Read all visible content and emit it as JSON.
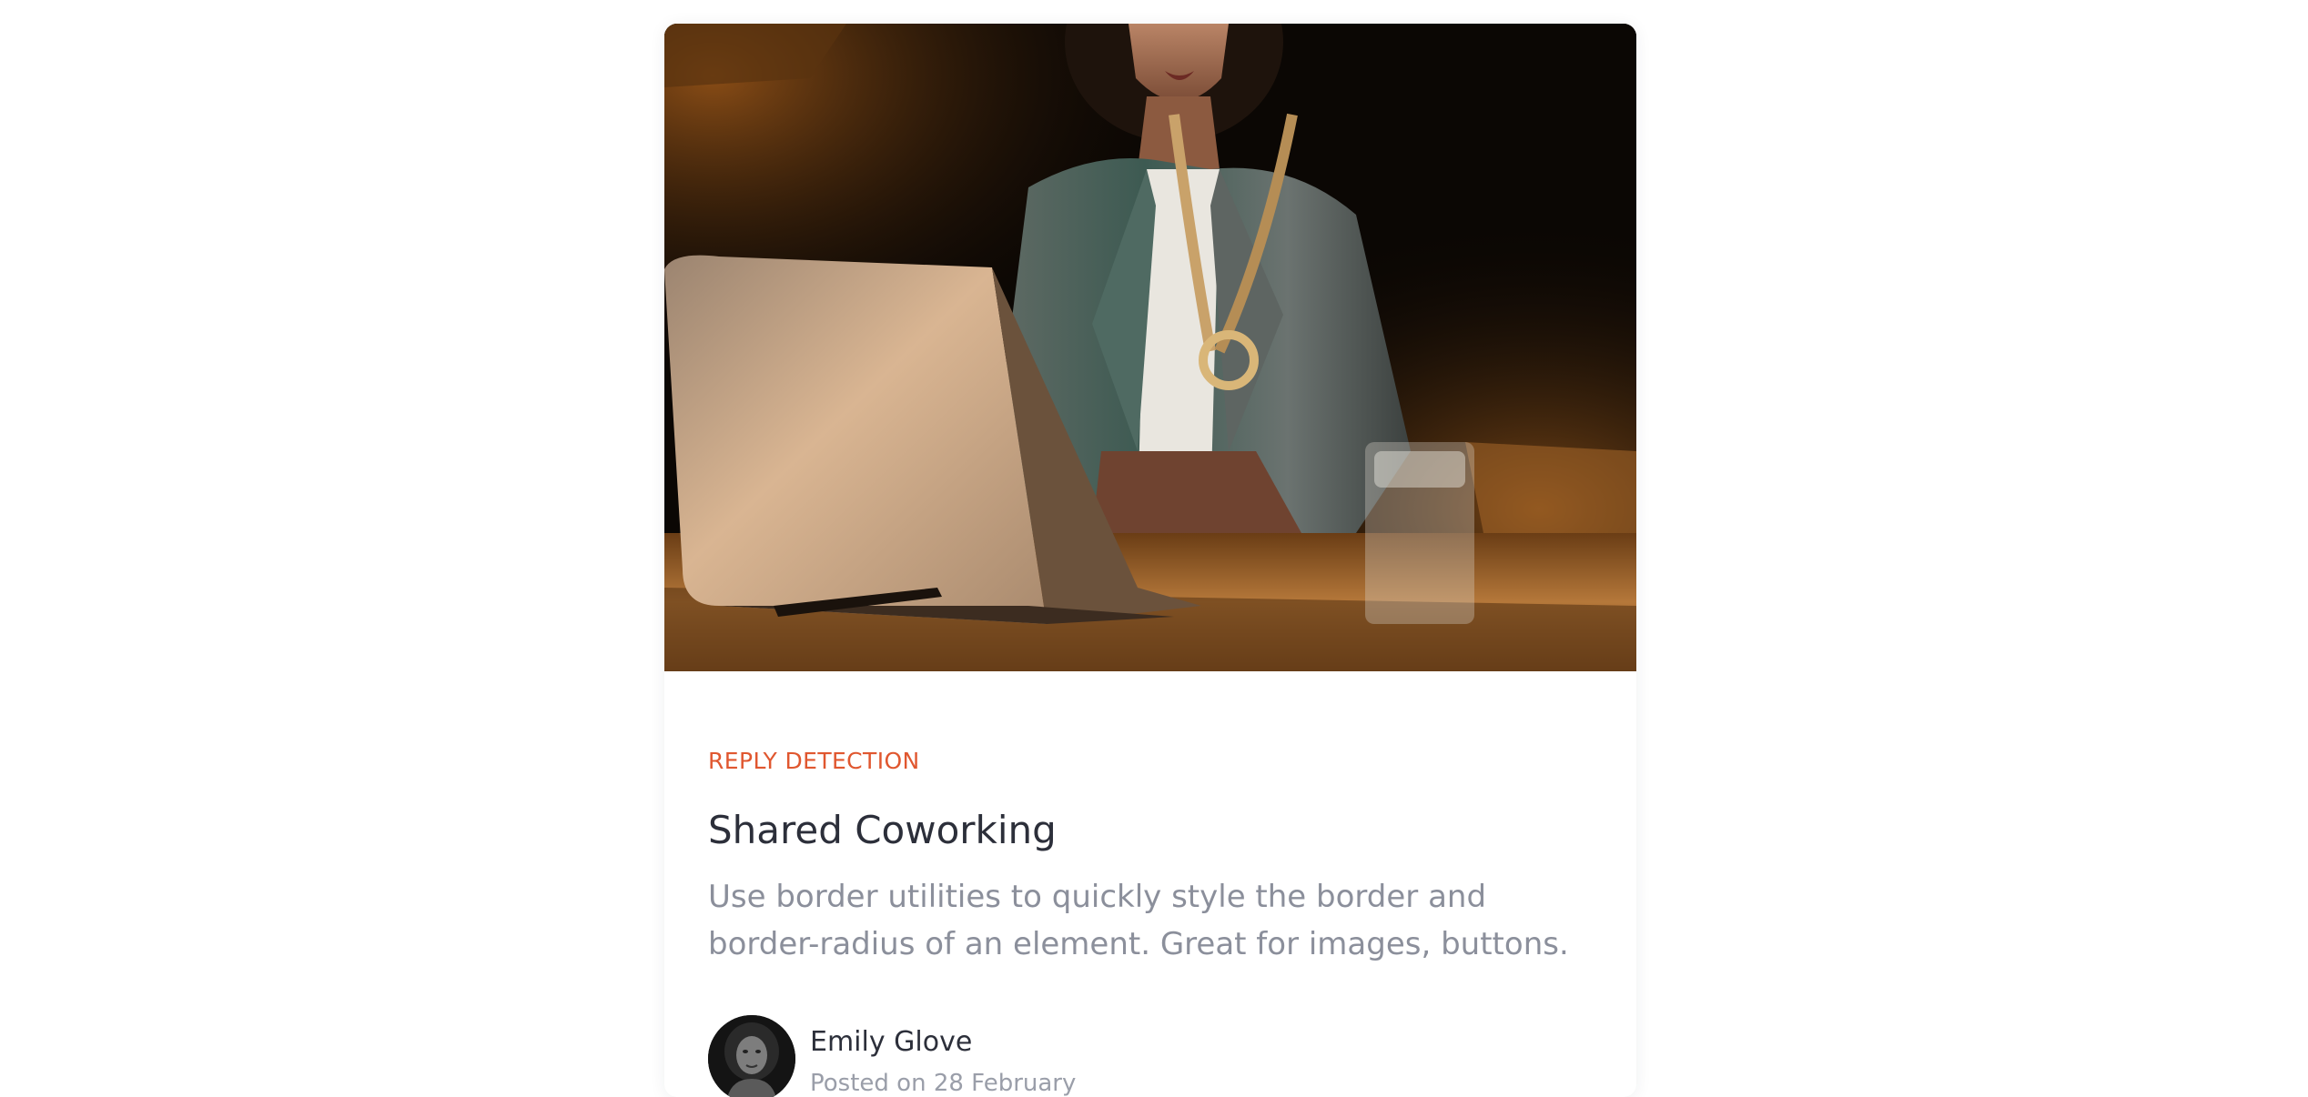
{
  "card": {
    "image_alt": "woman working on a laptop",
    "category": "REPLY DETECTION",
    "title": "Shared Coworking",
    "description": "Use border utilities to quickly style the border and border-radius of an element. Great for images, buttons.",
    "author": {
      "name": "Emily Glove",
      "posted": "Posted on 28 February"
    }
  },
  "colors": {
    "category": "#e0572f",
    "title": "#2c2f3a",
    "description": "#8b8f9b"
  }
}
